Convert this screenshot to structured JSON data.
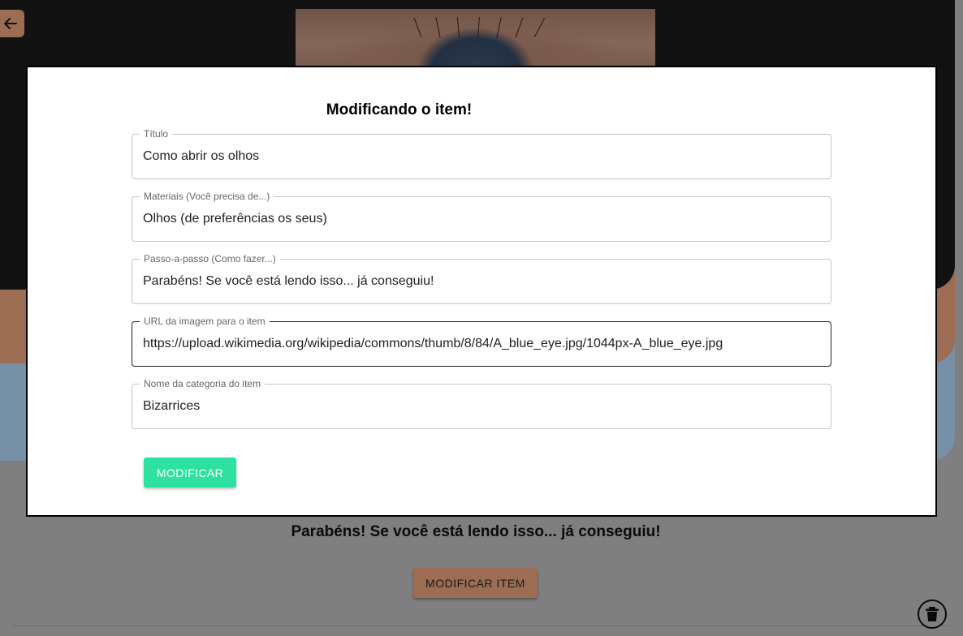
{
  "background": {
    "step_text": "Parabéns! Se você está lendo isso... já conseguiu!",
    "modify_item_label": "MODIFICAR ITEM",
    "back_icon": "arrow-left-icon",
    "delete_icon": "trash-icon"
  },
  "modal": {
    "title": "Modificando o item!",
    "fields": [
      {
        "label": "Título",
        "value": "Como abrir os olhos"
      },
      {
        "label": "Materiais (Você precisa de...)",
        "value": "Olhos (de preferências os seus)"
      },
      {
        "label": "Passo-a-passo (Como fazer...)",
        "value": "Parabéns! Se você está lendo isso... já conseguiu!"
      },
      {
        "label": "URL da imagem para o item",
        "value": "https://upload.wikimedia.org/wikipedia/commons/thumb/8/84/A_blue_eye.jpg/1044px-A_blue_eye.jpg"
      },
      {
        "label": "Nome da categoria do item",
        "value": "Bizarrices"
      }
    ],
    "submit_label": "MODIFICAR"
  },
  "colors": {
    "accent_green": "#2de1a0",
    "accent_orange": "#e89a6f",
    "accent_blue": "#a5cdf2",
    "dark_header": "#121212"
  }
}
